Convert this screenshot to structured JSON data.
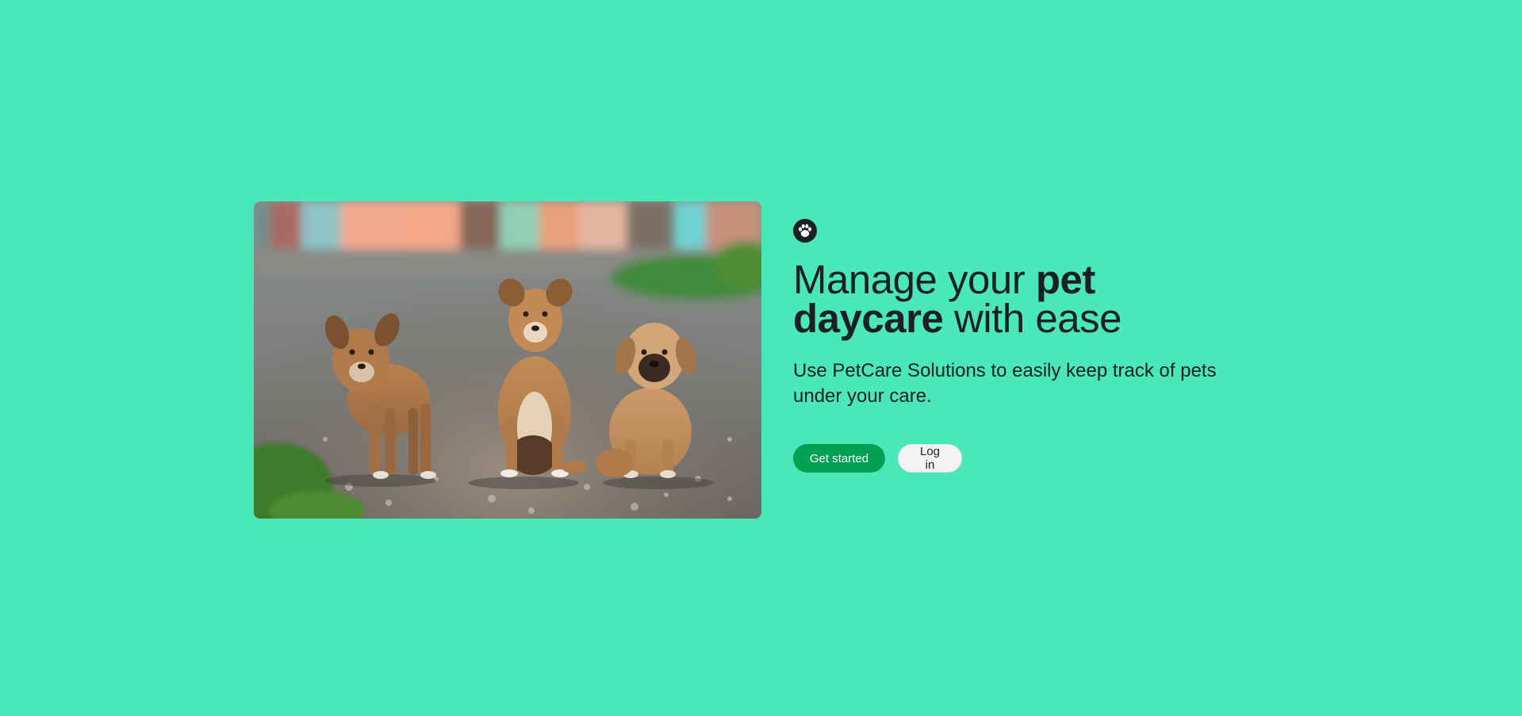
{
  "colors": {
    "background": "#4ae8b9",
    "primary": "#00a152",
    "secondary": "#f3f3f3",
    "text": "#1c1f23"
  },
  "logo": {
    "icon": "paw-icon"
  },
  "hero": {
    "image": {
      "icon": "puppies-photo"
    },
    "headline": {
      "part1": "Manage your ",
      "bold1": "pet",
      "bold2": "daycare",
      "part2": " with ease"
    },
    "subtitle": "Use PetCare Solutions to easily keep track of pets under your care.",
    "actions": {
      "primary_label": "Get started",
      "secondary_label": "Log in"
    }
  }
}
